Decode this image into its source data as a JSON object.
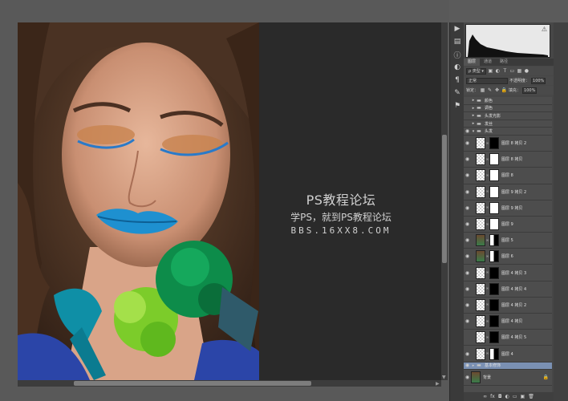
{
  "watermark": {
    "title": "PS教程论坛",
    "subtitle": "学PS，就到PS教程论坛",
    "url": "BBS.16XX8.COM"
  },
  "toolstrip": {
    "icons": [
      "play-icon",
      "histogram-icon",
      "info-icon",
      "adjustments-icon",
      "paragraph-icon",
      "brush-icon",
      "stamp-icon"
    ]
  },
  "panels": {
    "tabs": [
      "图层",
      "通道",
      "路径"
    ],
    "filter_label": "类型",
    "blend_mode": "正常",
    "opacity_label": "不透明度：",
    "opacity_value": "100%",
    "lock_label": "锁定：",
    "fill_label": "填充：",
    "fill_value": "100%"
  },
  "layers": [
    {
      "name": "颜色",
      "type": "group",
      "eye": false,
      "indent": 0
    },
    {
      "name": "调色",
      "type": "group",
      "eye": false,
      "indent": 0
    },
    {
      "name": "头发光影",
      "type": "group",
      "eye": false,
      "indent": 0
    },
    {
      "name": "发丝",
      "type": "group",
      "eye": false,
      "indent": 0
    },
    {
      "name": "头发",
      "type": "group-open",
      "eye": true,
      "indent": 0
    },
    {
      "name": "图层 8 拷贝 2",
      "type": "layer",
      "mask": "black",
      "eye": true,
      "indent": 1
    },
    {
      "name": "图层 8 拷贝",
      "type": "layer",
      "mask": "white",
      "eye": true,
      "indent": 1
    },
    {
      "name": "图层 8",
      "type": "layer",
      "mask": "white",
      "eye": true,
      "indent": 1
    },
    {
      "name": "图层 9 拷贝 2",
      "type": "layer",
      "mask": "white",
      "eye": true,
      "indent": 1
    },
    {
      "name": "图层 9 拷贝",
      "type": "layer",
      "mask": "white",
      "eye": true,
      "indent": 1
    },
    {
      "name": "图层 9",
      "type": "layer",
      "mask": "white",
      "eye": true,
      "indent": 1
    },
    {
      "name": "图层 5",
      "type": "face",
      "mask": "half",
      "eye": true,
      "indent": 1
    },
    {
      "name": "图层 6",
      "type": "face",
      "mask": "half",
      "eye": true,
      "indent": 1
    },
    {
      "name": "图层 4 拷贝 3",
      "type": "layer",
      "mask": "black",
      "eye": true,
      "indent": 1
    },
    {
      "name": "图层 4 拷贝 4",
      "type": "layer",
      "mask": "black",
      "eye": true,
      "indent": 1
    },
    {
      "name": "图层 4 拷贝 2",
      "type": "layer",
      "mask": "black",
      "eye": true,
      "indent": 1
    },
    {
      "name": "图层 4 拷贝",
      "type": "layer",
      "mask": "black",
      "eye": true,
      "indent": 1
    },
    {
      "name": "图层 4 拷贝 5",
      "type": "layer",
      "mask": "black",
      "eye": false,
      "indent": 1
    },
    {
      "name": "图层 4",
      "type": "layer",
      "mask": "half",
      "eye": true,
      "indent": 1
    },
    {
      "name": "基本修饰",
      "type": "group-selected",
      "eye": true,
      "indent": 0
    },
    {
      "name": "背景",
      "type": "background",
      "eye": true,
      "indent": 0
    }
  ],
  "colors": {
    "canvas_bg": "#2a2a2a",
    "panel_bg": "#474747",
    "selection": "#7a90b3",
    "lip_blue": "#1e90d0"
  }
}
